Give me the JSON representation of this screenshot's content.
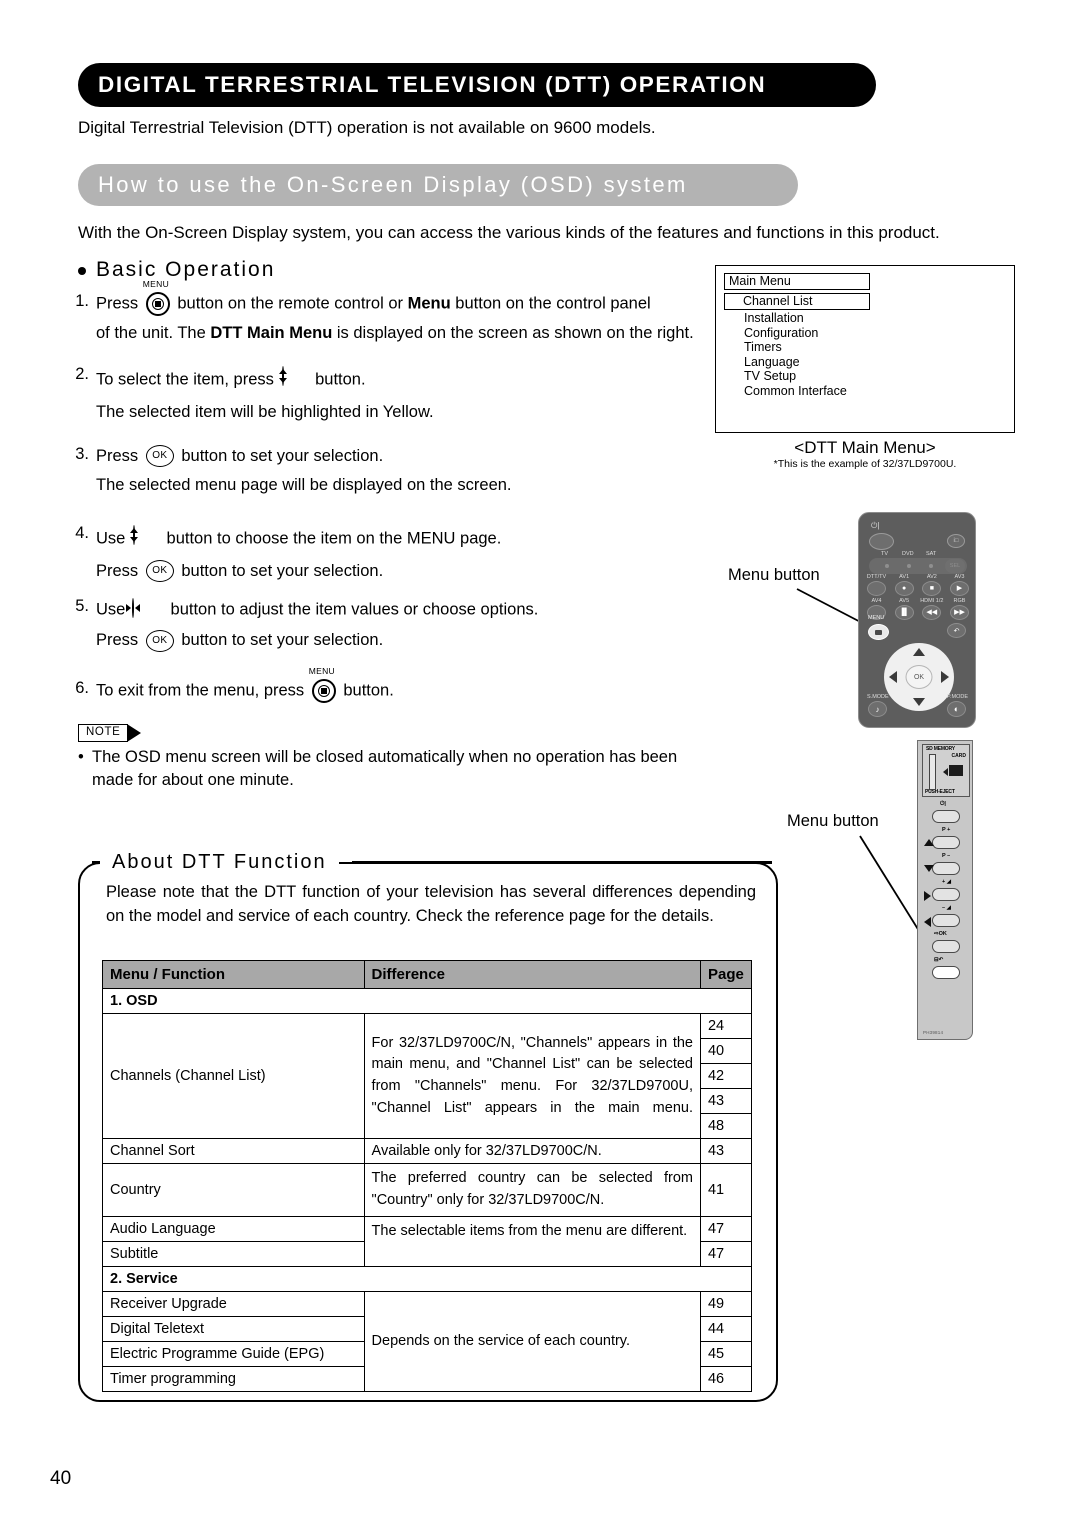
{
  "banner": {
    "title": "DIGITAL TERRESTRIAL TELEVISION (DTT) OPERATION"
  },
  "intro": "Digital Terrestrial Television (DTT) operation is not available on 9600 models.",
  "section": {
    "title": "How to use the On-Screen Display (OSD) system"
  },
  "lead": "With the On-Screen Display system, you can access the various kinds of the features and functions in this product.",
  "basic_operation": {
    "heading": "Basic Operation",
    "steps": [
      {
        "num": "1.",
        "pre": "Press",
        "icon": "menu-button-icon",
        "icon_label": "MENU",
        "mid": "button on the remote control or",
        "bold1": "Menu",
        "post": "button on the control panel",
        "cont_a": "of the unit. The",
        "cont_bold": "DTT Main Menu",
        "cont_b": "is displayed on the screen as shown on the",
        "cont_c": "right."
      },
      {
        "num": "2.",
        "pre": "To select the item, press",
        "icon": "up-down-button-icon",
        "post": "button.",
        "sub": "The selected item will be highlighted in Yellow."
      },
      {
        "num": "3.",
        "pre": "Press",
        "icon": "ok-button-icon",
        "icon_label": "OK",
        "post": "button to set your selection.",
        "sub": "The selected menu page will be displayed on the screen."
      },
      {
        "num": "4.",
        "pre": "Use",
        "icon": "up-down-button-icon",
        "post": "button to choose the item on the MENU page.",
        "sub_pre": "Press",
        "sub_icon": "ok-button-icon",
        "sub_icon_label": "OK",
        "sub_post": "button to set your selection."
      },
      {
        "num": "5.",
        "pre": "Use",
        "icon": "left-right-button-icon",
        "post": "button to adjust the item values or choose options.",
        "sub_pre": "Press",
        "sub_icon": "ok-button-icon",
        "sub_icon_label": "OK",
        "sub_post": "button to set your selection."
      },
      {
        "num": "6.",
        "pre": "To exit from the menu, press",
        "icon": "menu-button-icon",
        "icon_label": "MENU",
        "post": "button."
      }
    ]
  },
  "note": {
    "tag": "NOTE",
    "bullet": "•",
    "text": "The OSD menu screen will be closed automatically when no operation has been made for about one minute."
  },
  "osd": {
    "title": "Main Menu",
    "items": [
      {
        "label": "Channel List",
        "selected": true
      },
      {
        "label": "Installation",
        "selected": false
      },
      {
        "label": "Configuration",
        "selected": false
      },
      {
        "label": "Timers",
        "selected": false
      },
      {
        "label": "Language",
        "selected": false
      },
      {
        "label": "TV Setup",
        "selected": false
      },
      {
        "label": "Common Interface",
        "selected": false
      }
    ],
    "caption": "<DTT Main Menu>",
    "footnote": "*This is the example of 32/37LD9700U."
  },
  "callouts": {
    "remote_label": "Menu button",
    "panel_label": "Menu button"
  },
  "remote": {
    "power_label": "⏻|",
    "topright_label": "i□",
    "mode_labels": [
      "TV",
      "DVD",
      "SAT"
    ],
    "sel_label": "SEL",
    "keys_row1": [
      {
        "label": "DTT/TV",
        "sym": ""
      },
      {
        "label": "AV1",
        "sym": "●"
      },
      {
        "label": "AV2",
        "sym": "■"
      },
      {
        "label": "AV3",
        "sym": "▶"
      }
    ],
    "keys_row2": [
      {
        "label": "AV4",
        "sym": ""
      },
      {
        "label": "AV5",
        "sym": "▐▌"
      },
      {
        "label": "HDMI 1/2",
        "sym": "◀◀"
      },
      {
        "label": "RGB",
        "sym": "▶▶"
      }
    ],
    "menu_label": "MENU",
    "back_sym": "↶",
    "ok_label": "OK",
    "smode_label": "S.MODE",
    "smode_sym": "♪",
    "pmode_label": "P.MODE",
    "pmode_sym": "◐"
  },
  "panel": {
    "sd_label_1": "SD MEMORY",
    "sd_label_2": "CARD",
    "sd_label_3": "PUSH-EJECT",
    "keys": [
      {
        "label": "⏻|",
        "tri": ""
      },
      {
        "label": "P +",
        "tri": "up"
      },
      {
        "label": "P –",
        "tri": "down"
      },
      {
        "label": "+ ◢",
        "tri": "right"
      },
      {
        "label": "– ◢",
        "tri": "left"
      },
      {
        "label": "⇨OK",
        "tri": ""
      },
      {
        "label": "⊟↶",
        "tri": "",
        "highlight": true
      }
    ],
    "code": "PH39814"
  },
  "about": {
    "title": "About DTT Function",
    "paragraph": "Please note that the DTT function of your television has several differences depending on the model and service of each country. Check the reference page for the details.",
    "table": {
      "headers": [
        "Menu / Function",
        "Difference",
        "Page"
      ],
      "groups": [
        {
          "label": "1. OSD",
          "rows": [
            {
              "function": "Channels (Channel List)",
              "difference": "For 32/37LD9700C/N, \"Channels\" appears in the main menu, and \"Channel List\" can be selected from \"Channels\" menu. For 32/37LD9700U, \"Channel List\" appears in the main menu.",
              "pages": [
                "24",
                "40",
                "42",
                "43",
                "48"
              ]
            },
            {
              "function": "Channel Sort",
              "difference": "Available only for 32/37LD9700C/N.",
              "pages": [
                "43"
              ]
            },
            {
              "function": "Country",
              "difference": "The preferred country can be selected from \"Country\" only for 32/37LD9700C/N.",
              "pages": [
                "41"
              ]
            },
            {
              "function": "Audio Language",
              "difference": "The selectable items from the menu are different.",
              "pages": [
                "47"
              ]
            },
            {
              "function": "Subtitle",
              "difference": "",
              "pages": [
                "47"
              ]
            }
          ]
        },
        {
          "label": "2. Service",
          "rows": [
            {
              "function": "Receiver Upgrade",
              "difference": "",
              "pages": [
                "49"
              ]
            },
            {
              "function": "Digital Teletext",
              "difference": "Depends on the service of each country.",
              "pages": [
                "44"
              ]
            },
            {
              "function": "Electric Programme Guide (EPG)",
              "difference": "",
              "pages": [
                "45"
              ]
            },
            {
              "function": "Timer programming",
              "difference": "",
              "pages": [
                "46"
              ]
            }
          ]
        }
      ]
    }
  },
  "page_number": "40"
}
